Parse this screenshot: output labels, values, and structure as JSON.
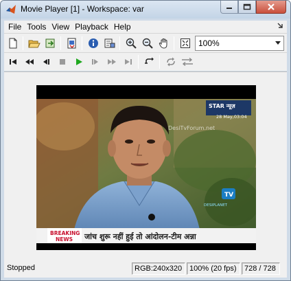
{
  "window": {
    "title": "Movie Player [1] - Workspace: var"
  },
  "menu": {
    "items": [
      "File",
      "Tools",
      "View",
      "Playback",
      "Help"
    ]
  },
  "toolbar": {
    "zoom_value": "100%"
  },
  "movie": {
    "channel_logo": "STAR न्यूज़",
    "timestamp": "28 May,03:04",
    "watermark": "DesiTvForum.net",
    "ticker_badge_line1": "BREAKING",
    "ticker_badge_line2": "NEWS",
    "ticker_text": "जांच शुरू नहीं हुई तो आंदोलन-टीम अन्ना",
    "corner_logo": "TV",
    "corner_caption": "DESIPLANET"
  },
  "status": {
    "state": "Stopped",
    "format": "RGB:240x320",
    "rate": "100% (20 fps)",
    "frame": "728 / 728"
  },
  "colors": {
    "play_green": "#1fa81f",
    "info_blue": "#2a5db0",
    "breaking_red": "#c8102e"
  }
}
